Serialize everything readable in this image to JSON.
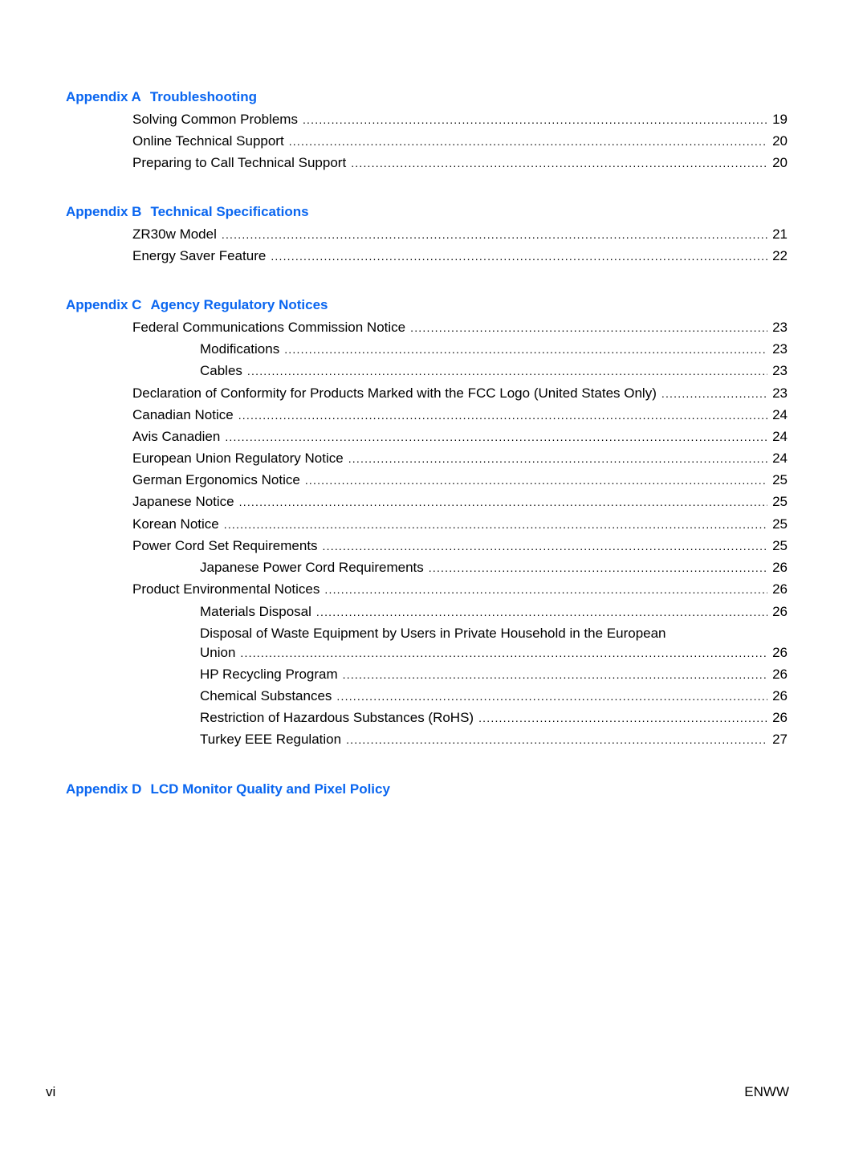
{
  "appendices": [
    {
      "label": "Appendix A",
      "title": "Troubleshooting",
      "entries": [
        {
          "title": "Solving Common Problems",
          "page": "19",
          "level": 1
        },
        {
          "title": "Online Technical Support",
          "page": "20",
          "level": 1
        },
        {
          "title": "Preparing to Call Technical Support",
          "page": "20",
          "level": 1
        }
      ]
    },
    {
      "label": "Appendix B",
      "title": "Technical Specifications",
      "entries": [
        {
          "title": "ZR30w Model",
          "page": "21",
          "level": 1
        },
        {
          "title": "Energy Saver Feature",
          "page": "22",
          "level": 1
        }
      ]
    },
    {
      "label": "Appendix C",
      "title": "Agency Regulatory Notices",
      "entries": [
        {
          "title": "Federal Communications Commission Notice",
          "page": "23",
          "level": 1
        },
        {
          "title": "Modifications",
          "page": "23",
          "level": 2
        },
        {
          "title": "Cables",
          "page": "23",
          "level": 2
        },
        {
          "title": "Declaration of Conformity for Products Marked with the FCC Logo (United States Only)",
          "page": "23",
          "level": 1
        },
        {
          "title": "Canadian Notice",
          "page": "24",
          "level": 1
        },
        {
          "title": "Avis Canadien",
          "page": "24",
          "level": 1
        },
        {
          "title": "European Union Regulatory Notice",
          "page": "24",
          "level": 1
        },
        {
          "title": "German Ergonomics Notice",
          "page": "25",
          "level": 1
        },
        {
          "title": "Japanese Notice",
          "page": "25",
          "level": 1
        },
        {
          "title": "Korean Notice",
          "page": "25",
          "level": 1
        },
        {
          "title": "Power Cord Set Requirements",
          "page": "25",
          "level": 1
        },
        {
          "title": "Japanese Power Cord Requirements",
          "page": "26",
          "level": 2
        },
        {
          "title": "Product Environmental Notices",
          "page": "26",
          "level": 1
        },
        {
          "title": "Materials Disposal",
          "page": "26",
          "level": 2
        },
        {
          "title_line1": "Disposal of Waste Equipment by Users in Private Household in the European",
          "title": "Union",
          "page": "26",
          "level": 2
        },
        {
          "title": "HP Recycling Program",
          "page": "26",
          "level": 2
        },
        {
          "title": "Chemical Substances",
          "page": "26",
          "level": 2
        },
        {
          "title": "Restriction of Hazardous Substances (RoHS)",
          "page": "26",
          "level": 2
        },
        {
          "title": "Turkey EEE Regulation",
          "page": "27",
          "level": 2
        }
      ]
    },
    {
      "label": "Appendix D",
      "title": "LCD Monitor Quality and Pixel Policy",
      "entries": []
    }
  ],
  "footer": {
    "page_number": "vi",
    "doc_code": "ENWW"
  }
}
